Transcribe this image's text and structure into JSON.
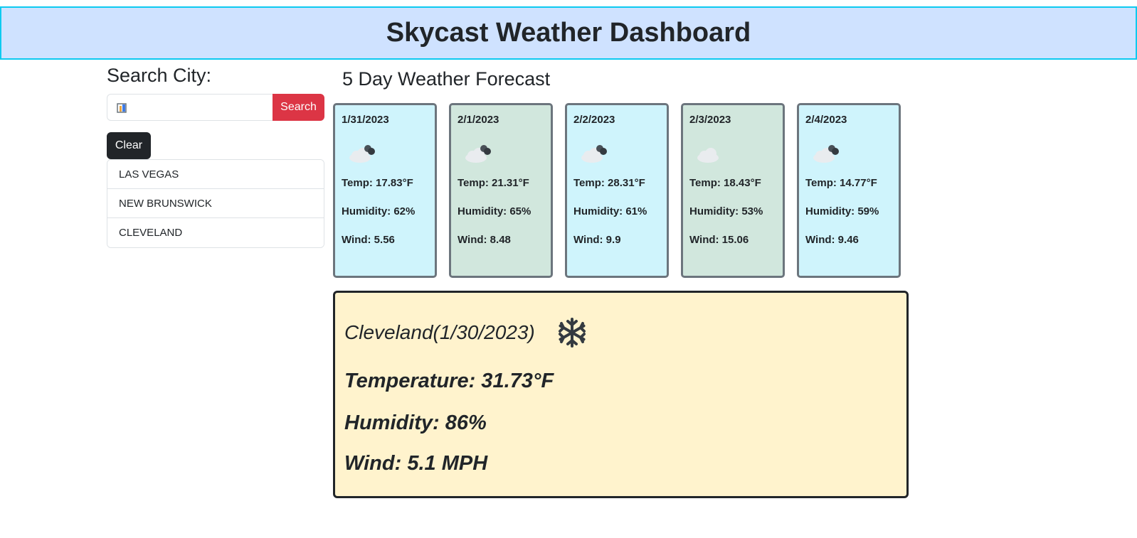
{
  "header": {
    "title": "Skycast Weather Dashboard"
  },
  "search": {
    "label": "Search City:",
    "input_value": "",
    "button_label": "Search",
    "clear_label": "Clear"
  },
  "history": [
    {
      "label": "LAS VEGAS"
    },
    {
      "label": "NEW BRUNSWICK"
    },
    {
      "label": "CLEVELAND"
    }
  ],
  "forecast": {
    "title": "5 Day Weather Forecast",
    "days": [
      {
        "date": "1/31/2023",
        "icon": "cloud-icon",
        "temp": "Temp: 17.83°F",
        "humidity": "Humidity: 62%",
        "wind": "Wind: 5.56"
      },
      {
        "date": "2/1/2023",
        "icon": "cloud-icon",
        "temp": "Temp: 21.31°F",
        "humidity": "Humidity: 65%",
        "wind": "Wind: 8.48"
      },
      {
        "date": "2/2/2023",
        "icon": "cloud-icon",
        "temp": "Temp: 28.31°F",
        "humidity": "Humidity: 61%",
        "wind": "Wind: 9.9"
      },
      {
        "date": "2/3/2023",
        "icon": "cloud-icon",
        "temp": "Temp: 18.43°F",
        "humidity": "Humidity: 53%",
        "wind": "Wind: 15.06"
      },
      {
        "date": "2/4/2023",
        "icon": "cloud-icon",
        "temp": "Temp: 14.77°F",
        "humidity": "Humidity: 59%",
        "wind": "Wind: 9.46"
      }
    ]
  },
  "current": {
    "title": "Cleveland(1/30/2023)",
    "icon": "snowflake-icon",
    "temperature": "Temperature: 31.73°F",
    "humidity": "Humidity: 86%",
    "wind": "Wind: 5.1 MPH"
  },
  "colors": {
    "header_bg": "#cfe2ff",
    "header_border": "#0dcaf0",
    "search_button": "#dc3545",
    "clear_button": "#212529",
    "card_info": "#cff4fc",
    "card_green": "#d1e7dd",
    "current_bg": "#fff3cd"
  }
}
